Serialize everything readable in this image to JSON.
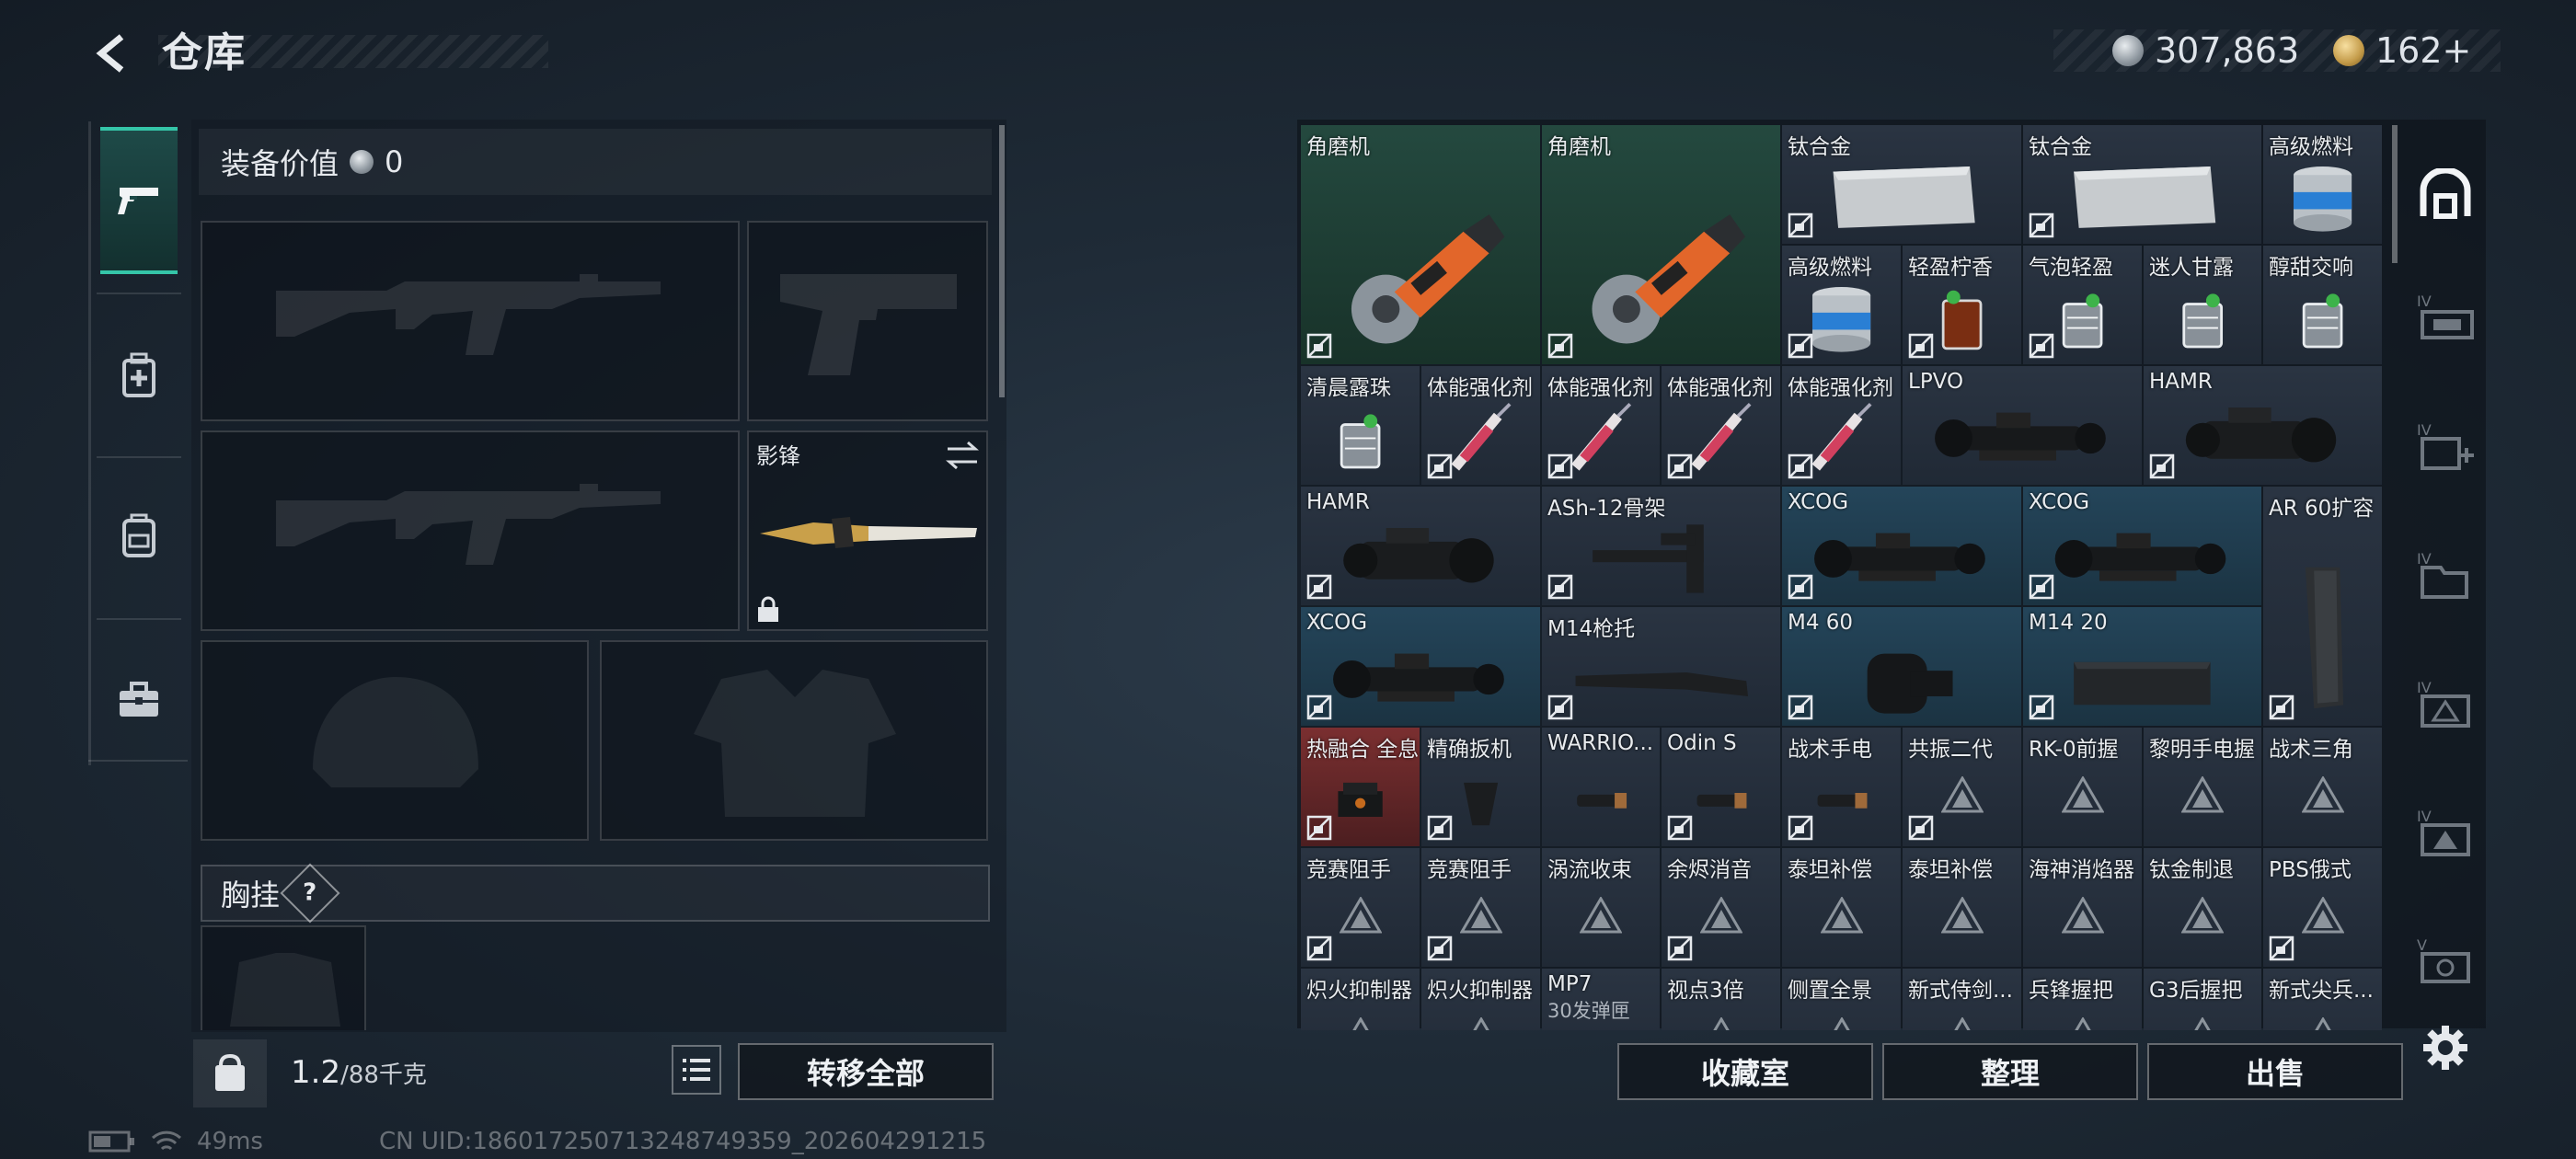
{
  "header": {
    "title": "仓库"
  },
  "currency": {
    "silver": "307,863",
    "gold": "162+"
  },
  "equipment": {
    "value_label": "装备价值",
    "value": "0",
    "melee_name": "影锋",
    "chest_label": "胸挂",
    "chest_help": "?"
  },
  "footer": {
    "weight": "1.2",
    "capacity": "/88千克",
    "transfer_all": "转移全部",
    "collection": "收藏室",
    "organize": "整理",
    "sell": "出售"
  },
  "status": {
    "ping": "49ms",
    "uid": "CN UID:186017250713248749359_202604291215"
  },
  "items": [
    {
      "name": "角磨机",
      "col": 0,
      "row": 0,
      "w": 2,
      "h": 2,
      "bg": "green",
      "img": "grinder",
      "locked": true
    },
    {
      "name": "角磨机",
      "col": 2,
      "row": 0,
      "w": 2,
      "h": 2,
      "bg": "green",
      "img": "grinder",
      "locked": true
    },
    {
      "name": "钛合金",
      "col": 4,
      "row": 0,
      "w": 2,
      "h": 1,
      "bg": "dark",
      "img": "plate",
      "locked": true
    },
    {
      "name": "钛合金",
      "col": 6,
      "row": 0,
      "w": 2,
      "h": 1,
      "bg": "dark",
      "img": "plate",
      "locked": true
    },
    {
      "name": "高级燃料",
      "col": 8,
      "row": 0,
      "w": 1,
      "h": 1,
      "bg": "dark",
      "img": "can",
      "locked": false
    },
    {
      "name": "高级燃料",
      "col": 4,
      "row": 1,
      "w": 1,
      "h": 1,
      "bg": "dark",
      "img": "can",
      "locked": true
    },
    {
      "name": "轻盈柠香",
      "col": 5,
      "row": 1,
      "w": 1,
      "h": 1,
      "bg": "dark",
      "img": "drink",
      "locked": true
    },
    {
      "name": "气泡轻盈",
      "col": 6,
      "row": 1,
      "w": 1,
      "h": 1,
      "bg": "dark",
      "img": "glass",
      "locked": true
    },
    {
      "name": "迷人甘露",
      "col": 7,
      "row": 1,
      "w": 1,
      "h": 1,
      "bg": "dark",
      "img": "glass",
      "locked": false
    },
    {
      "name": "醇甜交响",
      "col": 8,
      "row": 1,
      "w": 1,
      "h": 1,
      "bg": "dark",
      "img": "glass",
      "locked": false
    },
    {
      "name": "清晨露珠",
      "col": 0,
      "row": 2,
      "w": 1,
      "h": 1,
      "bg": "dark",
      "img": "glass",
      "locked": false
    },
    {
      "name": "体能强化剂",
      "col": 1,
      "row": 2,
      "w": 1,
      "h": 1,
      "bg": "dark",
      "img": "syringe",
      "locked": true
    },
    {
      "name": "体能强化剂",
      "col": 2,
      "row": 2,
      "w": 1,
      "h": 1,
      "bg": "dark",
      "img": "syringe",
      "locked": true
    },
    {
      "name": "体能强化剂",
      "col": 3,
      "row": 2,
      "w": 1,
      "h": 1,
      "bg": "dark",
      "img": "syringe",
      "locked": true
    },
    {
      "name": "体能强化剂",
      "col": 4,
      "row": 2,
      "w": 1,
      "h": 1,
      "bg": "dark",
      "img": "syringe",
      "locked": true
    },
    {
      "name": "LPVO",
      "col": 5,
      "row": 2,
      "w": 2,
      "h": 1,
      "bg": "dark",
      "img": "scope",
      "locked": false
    },
    {
      "name": "HAMR",
      "col": 7,
      "row": 2,
      "w": 2,
      "h": 1,
      "bg": "dark",
      "img": "hamr",
      "locked": true
    },
    {
      "name": "HAMR",
      "col": 0,
      "row": 3,
      "w": 2,
      "h": 1,
      "bg": "dark",
      "img": "hamr",
      "locked": true
    },
    {
      "name": "ASh-12骨架",
      "col": 2,
      "row": 3,
      "w": 2,
      "h": 1,
      "bg": "dark",
      "img": "frame",
      "locked": true
    },
    {
      "name": "XCOG",
      "col": 4,
      "row": 3,
      "w": 2,
      "h": 1,
      "bg": "blue",
      "img": "scope",
      "locked": true
    },
    {
      "name": "XCOG",
      "col": 6,
      "row": 3,
      "w": 2,
      "h": 1,
      "bg": "blue",
      "img": "scope",
      "locked": true
    },
    {
      "name": "AR 60扩容",
      "col": 8,
      "row": 3,
      "w": 1,
      "h": 2,
      "bg": "dark",
      "img": "mag",
      "locked": true
    },
    {
      "name": "XCOG",
      "col": 0,
      "row": 4,
      "w": 2,
      "h": 1,
      "bg": "blue",
      "img": "scope",
      "locked": true
    },
    {
      "name": "M14枪托",
      "col": 2,
      "row": 4,
      "w": 2,
      "h": 1,
      "bg": "dark",
      "img": "stock",
      "locked": true
    },
    {
      "name": "M4 60",
      "col": 4,
      "row": 4,
      "w": 2,
      "h": 1,
      "bg": "blue",
      "img": "drum",
      "locked": true
    },
    {
      "name": "M14 20",
      "col": 6,
      "row": 4,
      "w": 2,
      "h": 1,
      "bg": "blue",
      "img": "box",
      "locked": true
    },
    {
      "name": "热融合 全息",
      "col": 0,
      "row": 5,
      "w": 1,
      "h": 1,
      "bg": "red",
      "img": "holo",
      "locked": true
    },
    {
      "name": "精确扳机",
      "col": 1,
      "row": 5,
      "w": 1,
      "h": 1,
      "bg": "dark",
      "img": "trigger",
      "locked": true
    },
    {
      "name": "WARRIO...",
      "col": 2,
      "row": 5,
      "w": 1,
      "h": 1,
      "bg": "dark",
      "img": "light",
      "locked": false
    },
    {
      "name": "Odin S",
      "col": 3,
      "row": 5,
      "w": 1,
      "h": 1,
      "bg": "dark",
      "img": "light",
      "locked": true
    },
    {
      "name": "战术手电",
      "col": 4,
      "row": 5,
      "w": 1,
      "h": 1,
      "bg": "dark",
      "img": "light",
      "locked": true
    },
    {
      "name": "共振二代",
      "col": 5,
      "row": 5,
      "w": 1,
      "h": 1,
      "bg": "dark",
      "img": "tri",
      "locked": true
    },
    {
      "name": "RK-0前握",
      "col": 6,
      "row": 5,
      "w": 1,
      "h": 1,
      "bg": "dark",
      "img": "tri",
      "locked": false
    },
    {
      "name": "黎明手电握",
      "col": 7,
      "row": 5,
      "w": 1,
      "h": 1,
      "bg": "dark",
      "img": "tri",
      "locked": false
    },
    {
      "name": "战术三角",
      "col": 8,
      "row": 5,
      "w": 1,
      "h": 1,
      "bg": "dark",
      "img": "tri",
      "locked": false
    },
    {
      "name": "竞赛阻手",
      "col": 0,
      "row": 6,
      "w": 1,
      "h": 1,
      "bg": "dark",
      "img": "tri",
      "locked": true
    },
    {
      "name": "竞赛阻手",
      "col": 1,
      "row": 6,
      "w": 1,
      "h": 1,
      "bg": "dark",
      "img": "tri",
      "locked": true
    },
    {
      "name": "涡流收束",
      "col": 2,
      "row": 6,
      "w": 1,
      "h": 1,
      "bg": "dark",
      "img": "tri",
      "locked": false
    },
    {
      "name": "余烬消音",
      "col": 3,
      "row": 6,
      "w": 1,
      "h": 1,
      "bg": "dark",
      "img": "tri",
      "locked": true
    },
    {
      "name": "泰坦补偿",
      "col": 4,
      "row": 6,
      "w": 1,
      "h": 1,
      "bg": "dark",
      "img": "tri",
      "locked": false
    },
    {
      "name": "泰坦补偿",
      "col": 5,
      "row": 6,
      "w": 1,
      "h": 1,
      "bg": "dark",
      "img": "tri",
      "locked": false
    },
    {
      "name": "海神消焰器",
      "col": 6,
      "row": 6,
      "w": 1,
      "h": 1,
      "bg": "dark",
      "img": "tri",
      "locked": false
    },
    {
      "name": "钛金制退",
      "col": 7,
      "row": 6,
      "w": 1,
      "h": 1,
      "bg": "dark",
      "img": "tri",
      "locked": false
    },
    {
      "name": "PBS俄式",
      "col": 8,
      "row": 6,
      "w": 1,
      "h": 1,
      "bg": "dark",
      "img": "tri",
      "locked": true
    },
    {
      "name": "炽火抑制器",
      "col": 0,
      "row": 7,
      "w": 1,
      "h": 1,
      "bg": "dark",
      "img": "tri",
      "locked": false
    },
    {
      "name": "炽火抑制器",
      "col": 1,
      "row": 7,
      "w": 1,
      "h": 1,
      "bg": "dark",
      "img": "tri",
      "locked": false
    },
    {
      "name": "MP7",
      "sub": "30发弹匣",
      "col": 2,
      "row": 7,
      "w": 1,
      "h": 1,
      "bg": "dark",
      "img": "none",
      "locked": false
    },
    {
      "name": "视点3倍",
      "col": 3,
      "row": 7,
      "w": 1,
      "h": 1,
      "bg": "dark",
      "img": "tri",
      "locked": false
    },
    {
      "name": "侧置全景",
      "col": 4,
      "row": 7,
      "w": 1,
      "h": 1,
      "bg": "dark",
      "img": "tri",
      "locked": false
    },
    {
      "name": "新式侍剑...",
      "col": 5,
      "row": 7,
      "w": 1,
      "h": 1,
      "bg": "dark",
      "img": "tri",
      "locked": false
    },
    {
      "name": "兵锋握把",
      "col": 6,
      "row": 7,
      "w": 1,
      "h": 1,
      "bg": "dark",
      "img": "tri",
      "locked": false
    },
    {
      "name": "G3后握把",
      "col": 7,
      "row": 7,
      "w": 1,
      "h": 1,
      "bg": "dark",
      "img": "tri",
      "locked": false
    },
    {
      "name": "新式尖兵...",
      "col": 8,
      "row": 7,
      "w": 1,
      "h": 1,
      "bg": "dark",
      "img": "tri",
      "locked": false
    }
  ],
  "colors": {
    "accent": "#35c5a8",
    "green_cell": "#1d3a33",
    "blue_cell": "#1c3140",
    "red_cell": "#5e2628",
    "dark_cell": "#222c38"
  }
}
